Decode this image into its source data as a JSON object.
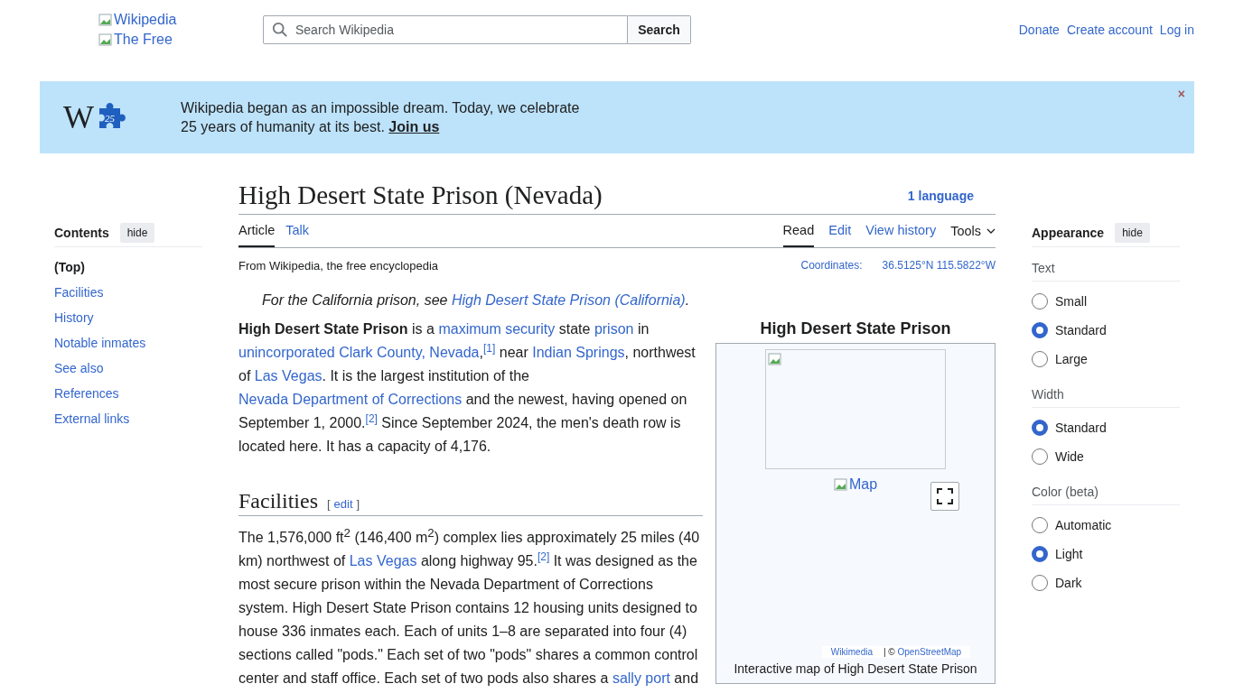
{
  "header": {
    "logo_alts": [
      "Wikipedia",
      "The Free"
    ],
    "search": {
      "placeholder": "Search Wikipedia",
      "button": "Search"
    },
    "user_links": [
      "Donate",
      "Create account",
      "Log in"
    ]
  },
  "banner": {
    "logo_letter": "W",
    "logo_badge": "25",
    "text": "Wikipedia began as an impossible dream. Today, we celebrate 25 years of humanity at its best.",
    "link": "Join us",
    "close": "×"
  },
  "contents": {
    "title": "Contents",
    "hide": "hide",
    "items": [
      {
        "label": "(Top)",
        "selected": true
      },
      {
        "label": "Facilities",
        "selected": false
      },
      {
        "label": "History",
        "selected": false
      },
      {
        "label": "Notable inmates",
        "selected": false
      },
      {
        "label": "See also",
        "selected": false
      },
      {
        "label": "References",
        "selected": false
      },
      {
        "label": "External links",
        "selected": false
      }
    ]
  },
  "article": {
    "title": "High Desert State Prison (Nevada)",
    "languages": "1 language",
    "left_tabs": [
      {
        "label": "Article",
        "selected": true
      },
      {
        "label": "Talk",
        "selected": false
      }
    ],
    "right_tabs": [
      {
        "label": "Read",
        "selected": true
      },
      {
        "label": "Edit",
        "selected": false
      },
      {
        "label": "View history",
        "selected": false
      }
    ],
    "tools": "Tools",
    "tagline": "From Wikipedia, the free encyclopedia",
    "coordinates_label": "Coordinates:",
    "coordinates": "36.5125°N 115.5822°W",
    "hatnote": [
      {
        "kind": "text",
        "text": "For the California prison, see "
      },
      {
        "kind": "link",
        "text": "High Desert State Prison (California)"
      },
      {
        "kind": "text",
        "text": "."
      }
    ],
    "intro": [
      {
        "kind": "bold",
        "text": "High Desert State Prison"
      },
      {
        "kind": "text",
        "text": " is a "
      },
      {
        "kind": "link",
        "text": "maximum security"
      },
      {
        "kind": "text",
        "text": " state "
      },
      {
        "kind": "link",
        "text": "prison"
      },
      {
        "kind": "text",
        "text": " in "
      },
      {
        "kind": "link",
        "text": "unincorporated Clark County, Nevada"
      },
      {
        "kind": "text",
        "text": ","
      },
      {
        "kind": "ref",
        "text": "[1]"
      },
      {
        "kind": "text",
        "text": " near "
      },
      {
        "kind": "link",
        "text": "Indian Springs"
      },
      {
        "kind": "text",
        "text": ", northwest of "
      },
      {
        "kind": "link",
        "text": "Las Vegas"
      },
      {
        "kind": "text",
        "text": ". It is the largest institution of the "
      },
      {
        "kind": "link",
        "text": "Nevada Department of Corrections"
      },
      {
        "kind": "text",
        "text": " and the newest, having opened on September 1, 2000."
      },
      {
        "kind": "ref",
        "text": "[2]"
      },
      {
        "kind": "text",
        "text": " Since September 2024, the men's death row is located here. It has a capacity of 4,176."
      }
    ],
    "sections": [
      {
        "heading": "Facilities",
        "edit_open": "[",
        "edit": "edit",
        "edit_close": "]",
        "paragraph": [
          {
            "kind": "text",
            "text": "The 1,576,000 ft$^{2}$ (146,400 m$^{2}$) complex lies approximately 25 miles (40 km) northwest of "
          },
          {
            "kind": "link",
            "text": "Las Vegas"
          },
          {
            "kind": "text",
            "text": " along highway 95."
          },
          {
            "kind": "ref",
            "text": "[2]"
          },
          {
            "kind": "text",
            "text": " It was designed as the most secure prison within the Nevada Department of Corrections system. High Desert State Prison contains 12 housing units designed to house 336 inmates each. Each of units 1–8 are separated into four (4) sections called \"pods.\" Each set of two \"pods\" shares a common control center and staff office. Each set of two pods also shares a "
          },
          {
            "kind": "link",
            "text": "sally port"
          },
          {
            "kind": "text",
            "text": " and"
          }
        ]
      }
    ],
    "infobox": {
      "title": "High Desert State Prison",
      "map_alt": "Map",
      "attribution_links": [
        "Wikimedia",
        "OpenStreetMap"
      ],
      "attribution_sep": "| ©",
      "caption": "Interactive map of High Desert State Prison"
    }
  },
  "appearance": {
    "title": "Appearance",
    "hide": "hide",
    "groups": [
      {
        "label": "Text",
        "options": [
          {
            "label": "Small",
            "selected": false
          },
          {
            "label": "Standard",
            "selected": true
          },
          {
            "label": "Large",
            "selected": false
          }
        ]
      },
      {
        "label": "Width",
        "options": [
          {
            "label": "Standard",
            "selected": true
          },
          {
            "label": "Wide",
            "selected": false
          }
        ]
      },
      {
        "label": "Color (beta)",
        "options": [
          {
            "label": "Automatic",
            "selected": false
          },
          {
            "label": "Light",
            "selected": true
          },
          {
            "label": "Dark",
            "selected": false
          }
        ]
      }
    ]
  }
}
